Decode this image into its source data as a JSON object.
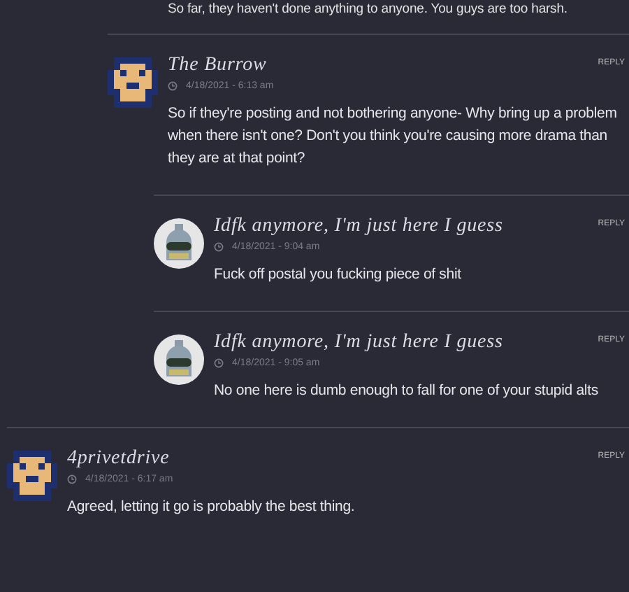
{
  "cut_off_comment_body": "So far, they haven't done anything to anyone. You guys are too harsh.",
  "comments": [
    {
      "author": "The Burrow",
      "avatar": {
        "kind": "pixel"
      },
      "date": "4/18/2021 - 6:13 am",
      "reply": "REPLY",
      "body": "So if they're posting and not bothering anyone- Why bring up a problem when there isn't one? Don't you think you're causing more drama than they are at that point?",
      "children": [
        {
          "author": "Idfk anymore, I'm just here I guess",
          "avatar": {
            "kind": "robot"
          },
          "date": "4/18/2021 - 9:04 am",
          "reply": "REPLY",
          "body": "Fuck off postal you fucking piece of shit"
        },
        {
          "author": "Idfk anymore, I'm just here I guess",
          "avatar": {
            "kind": "robot"
          },
          "date": "4/18/2021 - 9:05 am",
          "reply": "REPLY",
          "body": "No one here is dumb enough to fall for one of your stupid alts"
        }
      ]
    },
    {
      "author": "4privetdrive",
      "avatar": {
        "kind": "pixel"
      },
      "date": "4/18/2021 - 6:17 am",
      "reply": "REPLY",
      "body": "Agreed, letting it go is probably the best thing.",
      "top_level": true
    }
  ]
}
